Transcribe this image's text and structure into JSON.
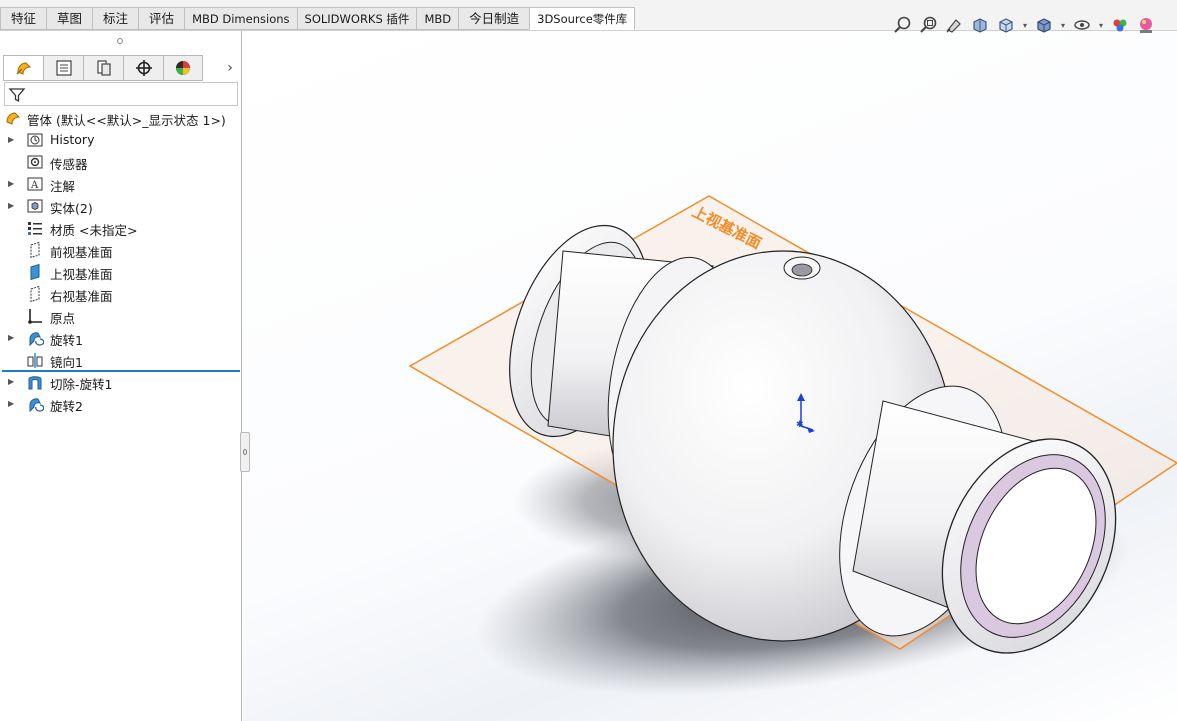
{
  "command_manager": {
    "tabs": [
      {
        "label": "特征"
      },
      {
        "label": "草图"
      },
      {
        "label": "标注"
      },
      {
        "label": "评估"
      },
      {
        "label": "MBD Dimensions"
      },
      {
        "label": "SOLIDWORKS 插件"
      },
      {
        "label": "MBD"
      },
      {
        "label": "今日制造"
      },
      {
        "label": "3DSource零件库",
        "active": true
      }
    ]
  },
  "view_toolbar": {
    "icons": [
      "zoom-to-fit-icon",
      "zoom-to-area-icon",
      "previous-view-icon",
      "section-view-icon",
      "view-orientation-icon",
      "display-style-icon",
      "hide-show-items-icon",
      "edit-appearance-icon",
      "apply-scene-icon"
    ]
  },
  "feature_manager": {
    "panel_tabs": [
      "feature-manager-tab-icon",
      "property-manager-tab-icon",
      "configuration-manager-tab-icon",
      "dimxpert-manager-tab-icon",
      "display-manager-tab-icon"
    ],
    "tree": {
      "root_label": "管体 (默认<<默认>_显示状态 1>)",
      "items": [
        {
          "label": "History",
          "icon": "history-icon",
          "expandable": true
        },
        {
          "label": "传感器",
          "icon": "sensors-icon",
          "expandable": false
        },
        {
          "label": "注解",
          "icon": "annotations-icon",
          "expandable": true
        },
        {
          "label": "实体(2)",
          "icon": "solid-bodies-icon",
          "expandable": true
        },
        {
          "label": "材质 <未指定>",
          "icon": "material-icon",
          "expandable": false
        },
        {
          "label": "前视基准面",
          "icon": "plane-icon",
          "expandable": false
        },
        {
          "label": "上视基准面",
          "icon": "plane-selected-icon",
          "expandable": false
        },
        {
          "label": "右视基准面",
          "icon": "plane-icon",
          "expandable": false
        },
        {
          "label": "原点",
          "icon": "origin-icon",
          "expandable": false
        },
        {
          "label": "旋转1",
          "icon": "revolve-icon",
          "expandable": true
        },
        {
          "label": "镜向1",
          "icon": "mirror-icon",
          "expandable": false
        },
        {
          "label": "切除-旋转1",
          "icon": "cut-revolve-icon",
          "expandable": true
        },
        {
          "label": "旋转2",
          "icon": "revolve-icon",
          "expandable": true
        }
      ]
    }
  },
  "graphics": {
    "plane_label": "上视基准面",
    "plane_color": "#f28c28",
    "part_color": "#f4f4f6",
    "flange_face_color": "#d9c8df",
    "triad_color": "#1c3fd8"
  }
}
